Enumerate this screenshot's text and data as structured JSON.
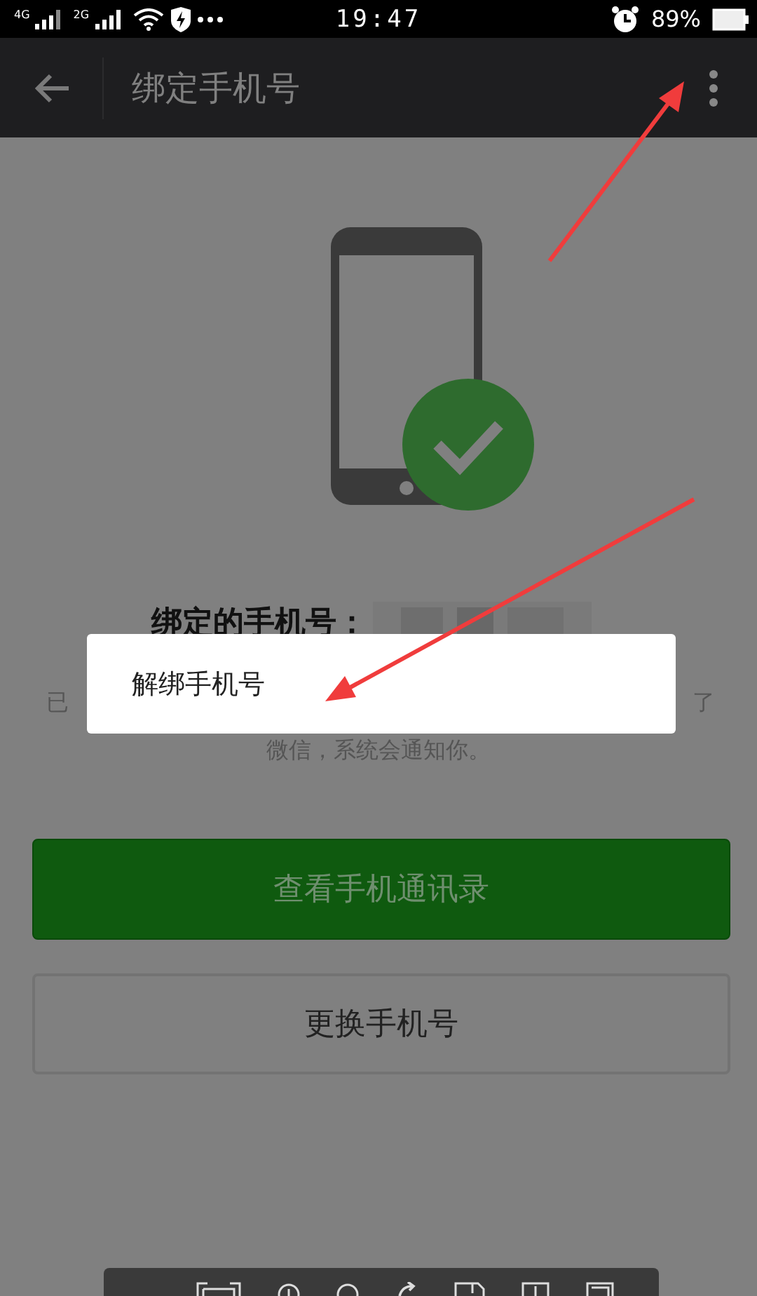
{
  "status_bar": {
    "network_1": "4G",
    "network_2": "2G",
    "time": "19:47",
    "battery": "89%"
  },
  "app_bar": {
    "title": "绑定手机号"
  },
  "content": {
    "heading": "绑定的手机号：",
    "notice_fragments": [
      "已",
      "了"
    ],
    "notice_line_2": "微信，系统会通知你。"
  },
  "buttons": [
    {
      "label": "查看手机通讯录",
      "kind": "primary"
    },
    {
      "label": "更换手机号",
      "kind": "outline"
    }
  ],
  "popup_menu": {
    "items": [
      {
        "label": "解绑手机号"
      }
    ]
  }
}
